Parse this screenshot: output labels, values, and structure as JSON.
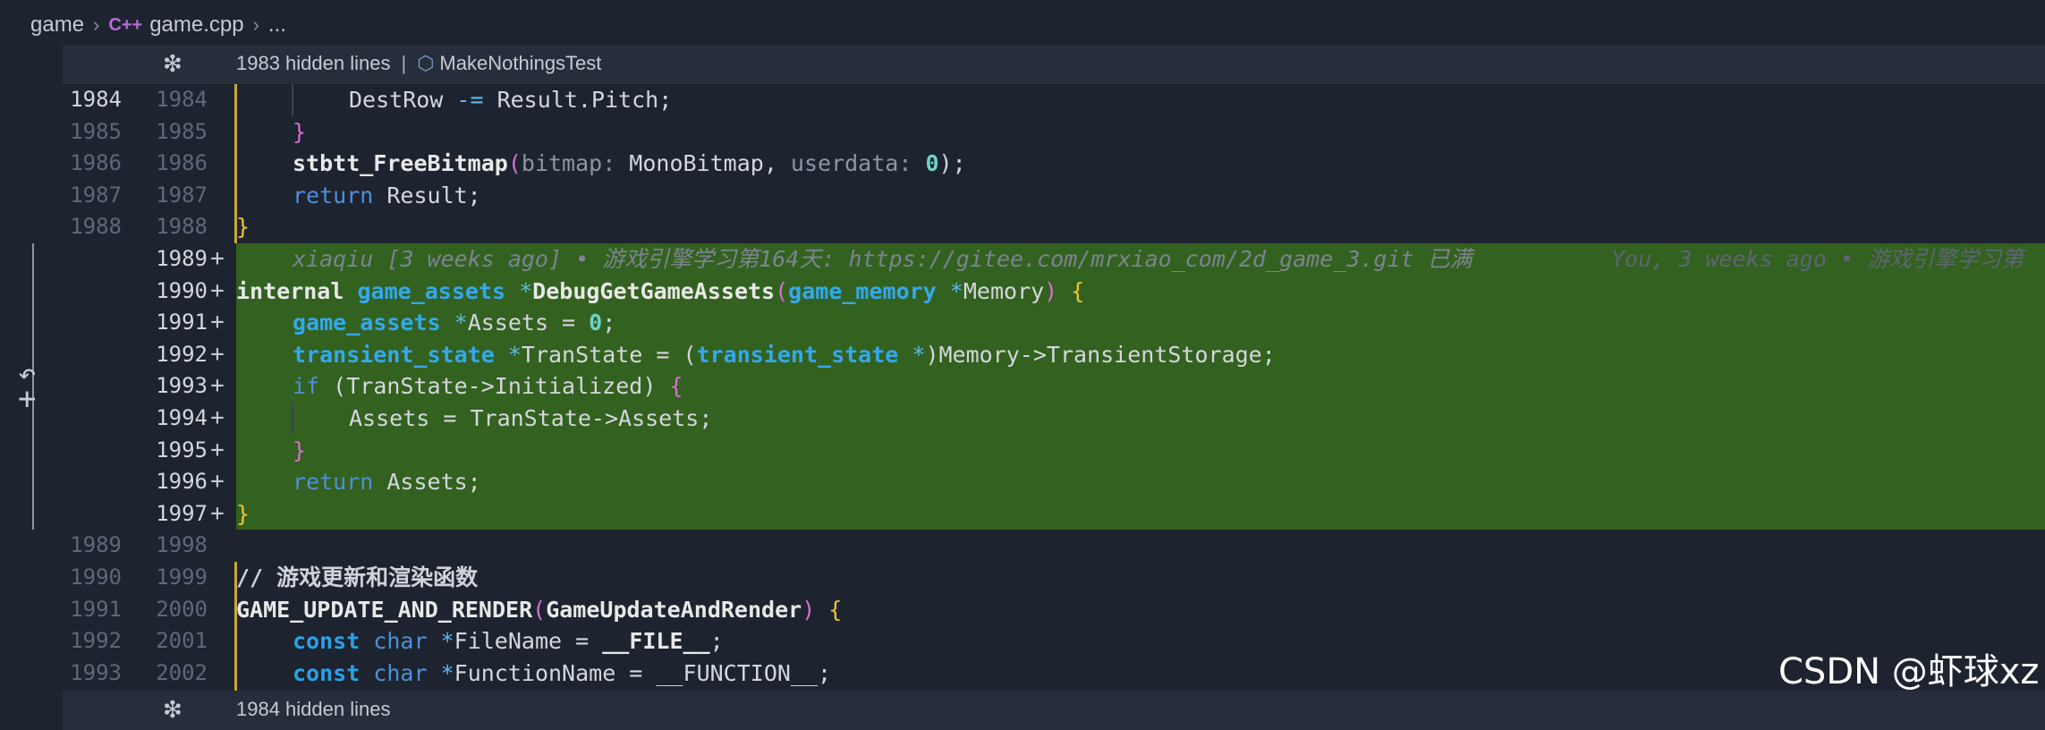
{
  "breadcrumb": {
    "folder": "game",
    "file_icon": "C++",
    "file": "game.cpp",
    "more": "..."
  },
  "hidden_top": {
    "count_text": "1983 hidden lines",
    "separator": "|",
    "symbol": "MakeNothingsTest"
  },
  "hidden_bottom": {
    "count_text": "1984 hidden lines"
  },
  "lines": [
    {
      "old": "1984",
      "new": "1984"
    },
    {
      "old": "1985",
      "new": "1985"
    },
    {
      "old": "1986",
      "new": "1986"
    },
    {
      "old": "1987",
      "new": "1987"
    },
    {
      "old": "1988",
      "new": "1988"
    },
    {
      "old": "",
      "new": "1989"
    },
    {
      "old": "",
      "new": "1990"
    },
    {
      "old": "",
      "new": "1991"
    },
    {
      "old": "",
      "new": "1992"
    },
    {
      "old": "",
      "new": "1993"
    },
    {
      "old": "",
      "new": "1994"
    },
    {
      "old": "",
      "new": "1995"
    },
    {
      "old": "",
      "new": "1996"
    },
    {
      "old": "",
      "new": "1997"
    },
    {
      "old": "1989",
      "new": "1998"
    },
    {
      "old": "1990",
      "new": "1999"
    },
    {
      "old": "1991",
      "new": "2000"
    },
    {
      "old": "1992",
      "new": "2001"
    },
    {
      "old": "1993",
      "new": "2002"
    }
  ],
  "plus_sign": "+",
  "code": {
    "l1984_a": "DestRow ",
    "l1984_op": "-=",
    "l1984_b": " Result.Pitch;",
    "l1985": "}",
    "l1986_fn": "stbtt_FreeBitmap",
    "l1986_p1": "bitmap:",
    "l1986_a1": " MonoBitmap, ",
    "l1986_p2": "userdata:",
    "l1986_a2": " ",
    "l1986_num": "0",
    "l1986_end": ");",
    "l1987_kw": "return",
    "l1987_rest": " Result;",
    "l1988": "}",
    "blame_left": "xiaqiu [3 weeks ago] • 游戏引擎学习第164天: https://gitee.com/mrxiao_com/2d_game_3.git 已满",
    "blame_right": "You, 3 weeks ago • 游戏引擎学习第",
    "l1990_kw": "internal",
    "l1990_type": "game_assets",
    "l1990_ptr": " *",
    "l1990_fn": "DebugGetGameAssets",
    "l1990_paren": "(",
    "l1990_type2": "game_memory",
    "l1990_ptr2": " *",
    "l1990_arg": "Memory",
    "l1990_close": ") ",
    "l1990_brace": "{",
    "l1991_type": "game_assets",
    "l1991_ptr": " *",
    "l1991_a": "Assets = ",
    "l1991_num": "0",
    "l1991_end": ";",
    "l1992_type": "transient_state",
    "l1992_ptr": " *",
    "l1992_a": "TranState = (",
    "l1992_type2": "transient_state",
    "l1992_ptr2": " *",
    "l1992_b": ")Memory->TransientStorage;",
    "l1993_kw": "if",
    "l1993_a": " (TranState->Initialized) ",
    "l1993_brace": "{",
    "l1994": "Assets = TranState->Assets;",
    "l1995": "}",
    "l1996_kw": "return",
    "l1996_rest": " Assets;",
    "l1997": "}",
    "l1999": "// 游戏更新和渲染函数",
    "l2000_macro": "GAME_UPDATE_AND_RENDER",
    "l2000_paren": "(",
    "l2000_arg": "GameUpdateAndRender",
    "l2000_close": ") ",
    "l2000_brace": "{",
    "l2001_kw": "const",
    "l2001_kw2": " char",
    "l2001_ptr": " *",
    "l2001_a": "FileName = ",
    "l2001_macro": "__FILE__",
    "l2001_end": ";",
    "l2002_kw": "const",
    "l2002_kw2": " char",
    "l2002_ptr": " *",
    "l2002_a": "FunctionName = __FUNCTION__;"
  },
  "watermark": "CSDN @虾球xz",
  "icons": [
    "chevron-right-icon",
    "cpp-file-icon",
    "unfold-icon",
    "cube-icon",
    "revert-icon",
    "plus-icon",
    "mouse-cursor-icon"
  ],
  "colors": {
    "added_background": "#33611f",
    "editor_background": "#1e2330"
  }
}
